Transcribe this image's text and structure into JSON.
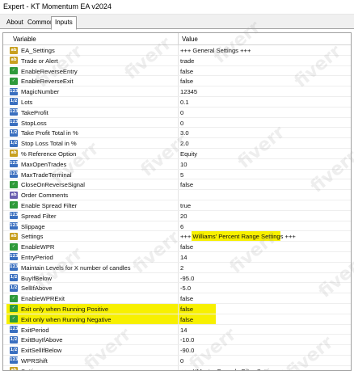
{
  "window": {
    "title": "Expert - KT Momentum EA v2024"
  },
  "tabs": [
    {
      "label": "About"
    },
    {
      "label": "Common"
    },
    {
      "label": "Inputs"
    }
  ],
  "grid": {
    "header": {
      "variable": "Variable",
      "value": "Value"
    },
    "rows": [
      {
        "icon": "ab",
        "name": "EA_Settings",
        "value": "+++ General Settings +++"
      },
      {
        "icon": "ab",
        "name": "Trade or Alert",
        "value": "trade"
      },
      {
        "icon": "bool",
        "name": "EnableReverseEntry",
        "value": "false"
      },
      {
        "icon": "bool",
        "name": "EnableReverseExit",
        "value": "false"
      },
      {
        "icon": "num",
        "name": "MagicNumber",
        "value": "12345"
      },
      {
        "icon": "dbl",
        "name": "Lots",
        "value": "0.1"
      },
      {
        "icon": "num",
        "name": "TakeProfit",
        "value": "0"
      },
      {
        "icon": "num",
        "name": "StopLoss",
        "value": "0"
      },
      {
        "icon": "dbl",
        "name": "Take Profit Total in %",
        "value": "3.0"
      },
      {
        "icon": "dbl",
        "name": "Stop Loss Total in %",
        "value": "2.0"
      },
      {
        "icon": "ab",
        "name": "% Reference Option",
        "value": "Equity"
      },
      {
        "icon": "num",
        "name": "MaxOpenTrades",
        "value": "10"
      },
      {
        "icon": "num",
        "name": "MaxTradeTerminal",
        "value": "5"
      },
      {
        "icon": "bool",
        "name": "CloseOnReverseSignal",
        "value": "false"
      },
      {
        "icon": "lst",
        "name": "Order Comments",
        "value": ""
      },
      {
        "icon": "bool",
        "name": "Enable Spread Filter",
        "value": "true"
      },
      {
        "icon": "num",
        "name": "Spread Filter",
        "value": "20"
      },
      {
        "icon": "num",
        "name": "Slippage",
        "value": "6"
      },
      {
        "icon": "ab",
        "name": "Settings",
        "value": "+++ Williams' Percent Range Settings +++"
      },
      {
        "icon": "bool",
        "name": "EnableWPR",
        "value": "false"
      },
      {
        "icon": "num",
        "name": "EntryPeriod",
        "value": "14"
      },
      {
        "icon": "num",
        "name": "Maintain Levels for X number of candles",
        "value": "2"
      },
      {
        "icon": "dbl",
        "name": "BuyIfBelow",
        "value": "-95.0"
      },
      {
        "icon": "dbl",
        "name": "SellIfAbove",
        "value": "-5.0"
      },
      {
        "icon": "bool",
        "name": "EnableWPRExit",
        "value": "false"
      },
      {
        "icon": "bool",
        "name": "Exit only when Running Positive",
        "value": "false"
      },
      {
        "icon": "bool",
        "name": "Exit only when Running Negative",
        "value": "false"
      },
      {
        "icon": "num",
        "name": "ExitPeriod",
        "value": "14"
      },
      {
        "icon": "dbl",
        "name": "ExitBuyIfAbove",
        "value": "-10.0"
      },
      {
        "icon": "dbl",
        "name": "ExitSellIfBelow",
        "value": "-90.0"
      },
      {
        "icon": "num",
        "name": "WPRShift",
        "value": "0"
      },
      {
        "icon": "ab",
        "name": "Settings",
        "value": "+++ XMaster Formula Filter Settings +++"
      }
    ]
  },
  "icons": {
    "ab": "ab",
    "num": "123",
    "dbl": "1/2",
    "bool": "✓",
    "lst": "ab"
  },
  "watermark": "fiverr",
  "colors": {
    "highlight": "#f7f000",
    "tab_border": "#a0a0a0"
  }
}
